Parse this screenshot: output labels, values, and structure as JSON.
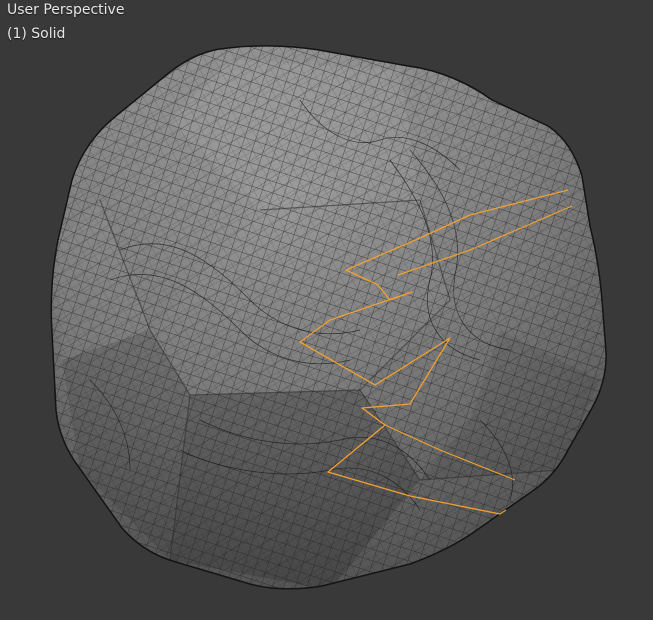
{
  "viewport": {
    "view_name": "User Perspective",
    "view_info": "(1) Solid",
    "background_color": "#393939",
    "text_color": "#e6e6e6"
  },
  "mesh": {
    "shape": "rounded dodecahedron",
    "shading": "solid",
    "wireframe_overlay": true,
    "face_color": "#8c8c8c",
    "wire_color": "#1c1c1c",
    "selected_edge_color": "#f0a030"
  }
}
